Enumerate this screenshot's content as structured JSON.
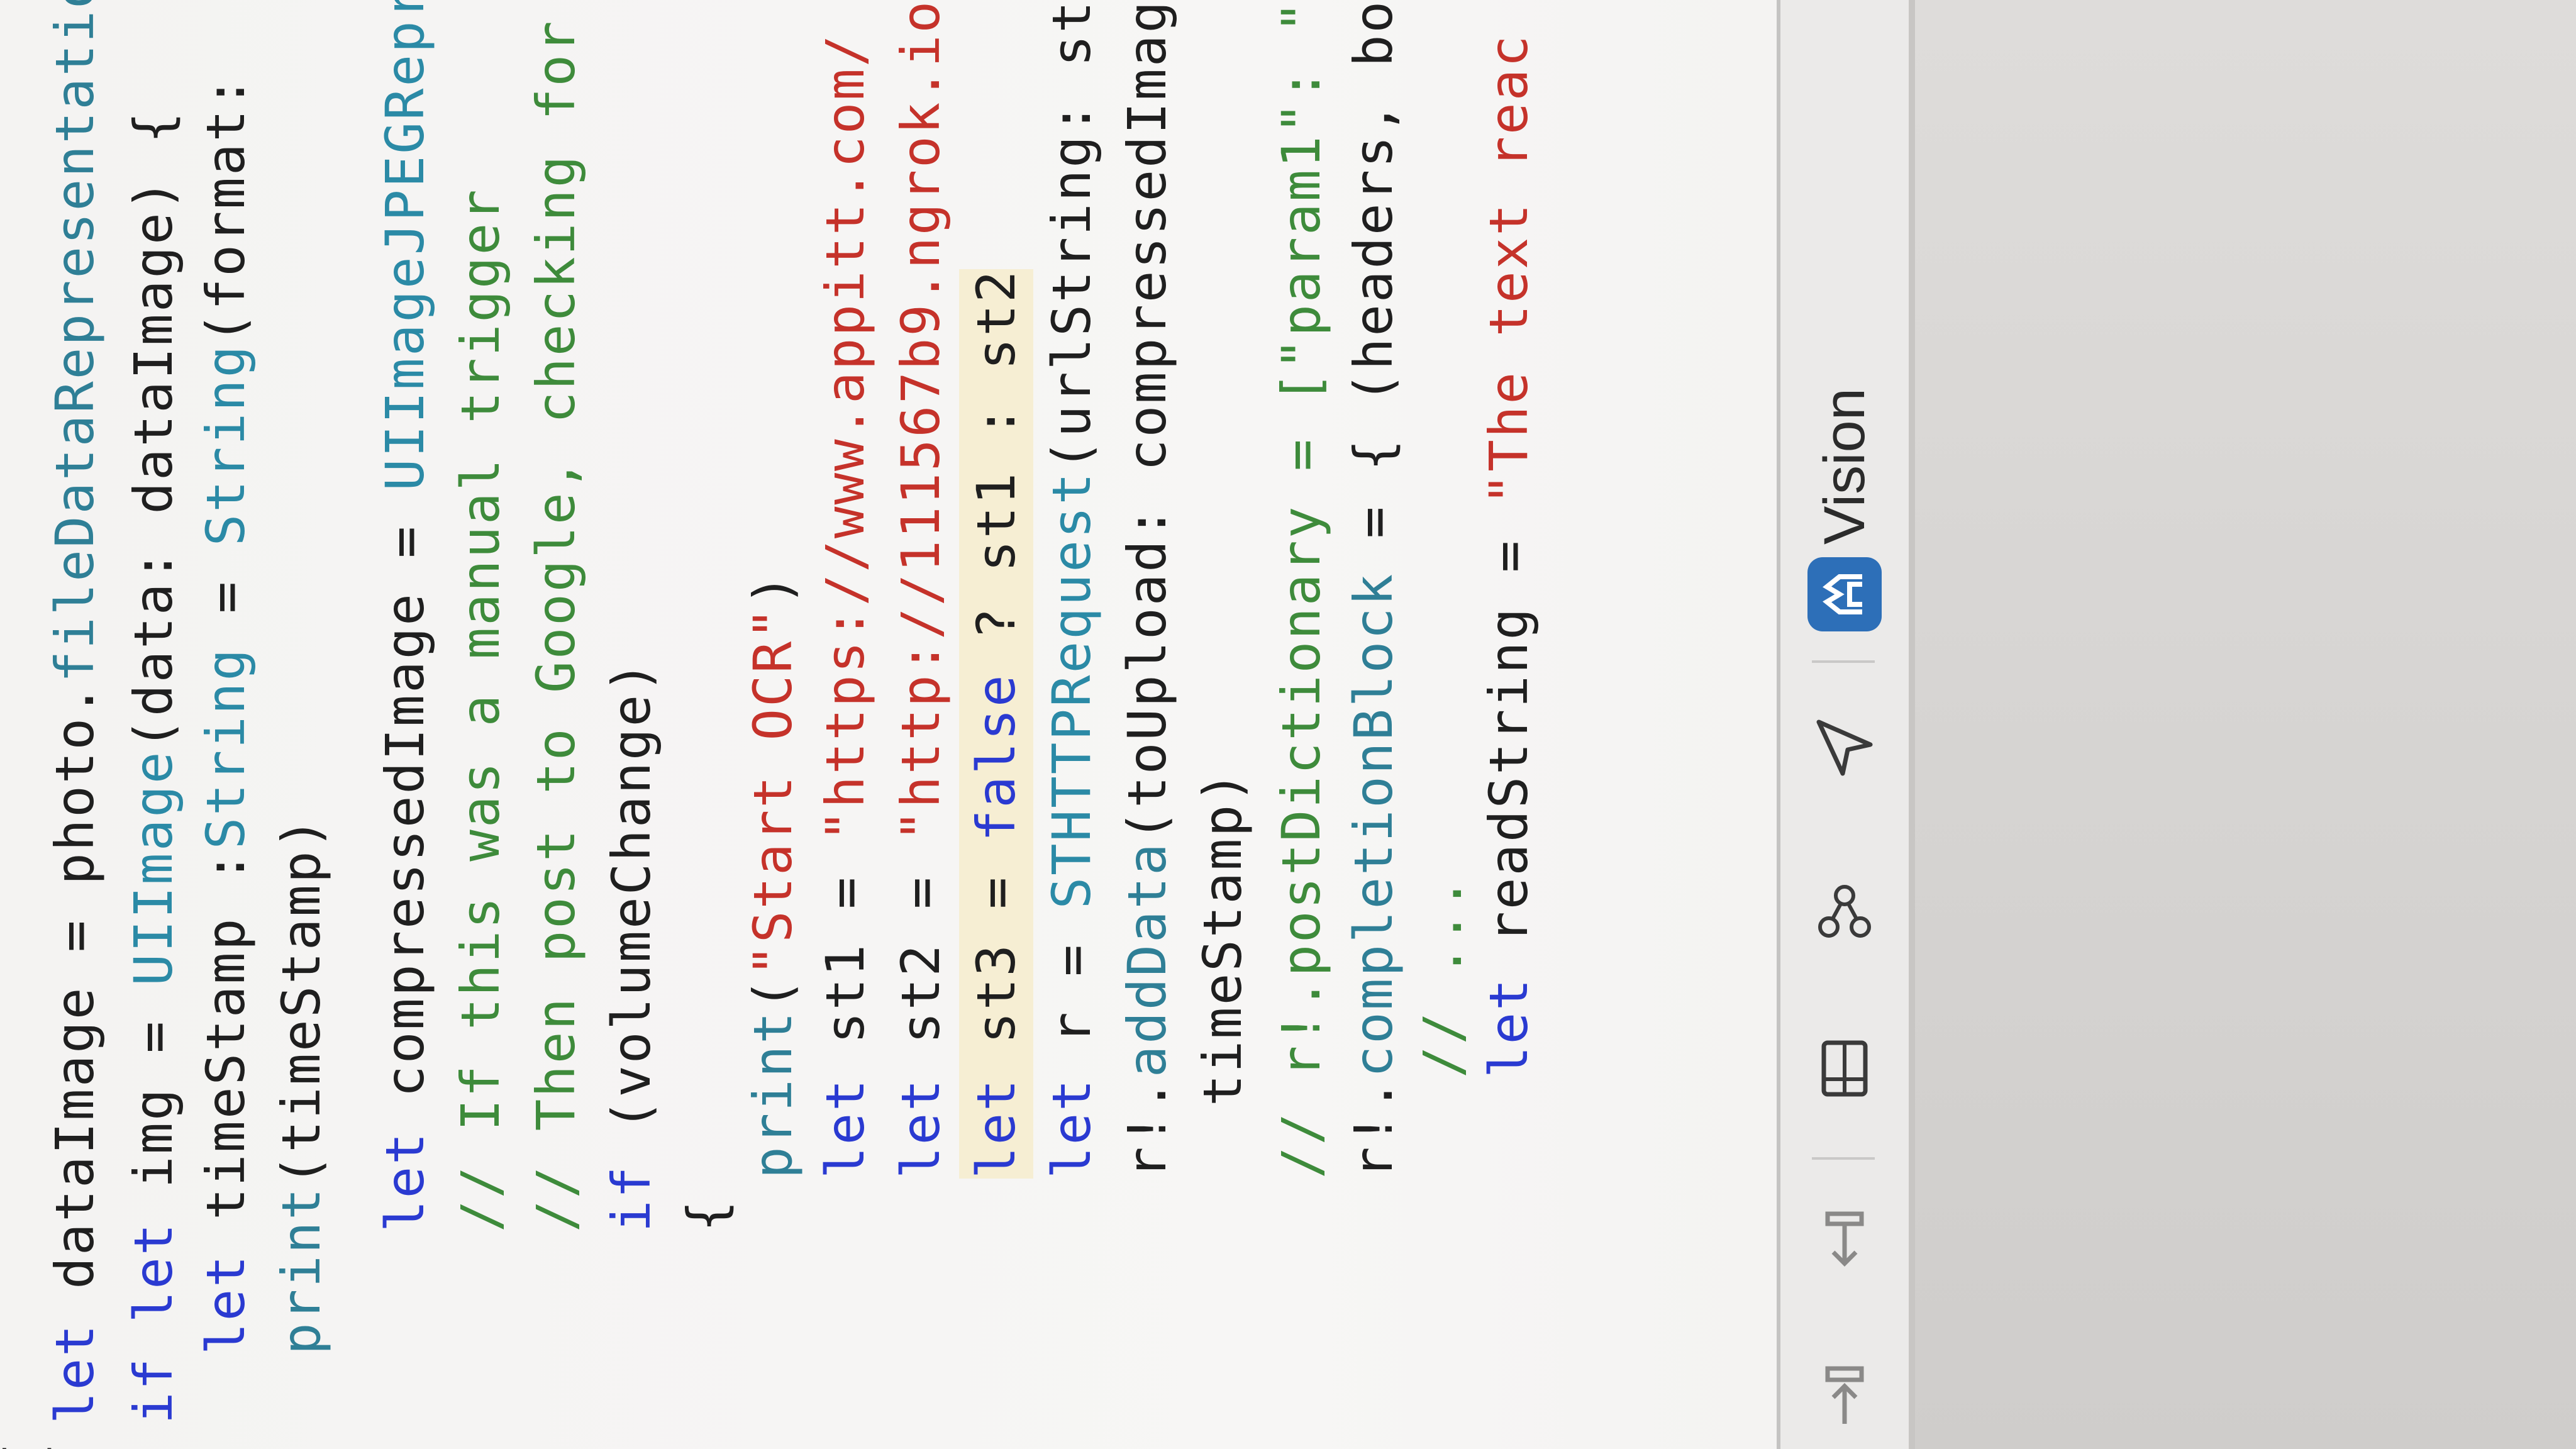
{
  "editor": {
    "lines": [
      {
        "id": "l0",
        "segments": [
          {
            "t": "{",
            "c": ""
          }
        ]
      },
      {
        "id": "l1",
        "segments": [
          {
            "t": "let",
            "c": "kw"
          },
          {
            "t": " dataImage = photo.",
            "c": ""
          },
          {
            "t": "fileDataRepresentatio",
            "c": "fn"
          }
        ]
      },
      {
        "id": "l2",
        "segments": [
          {
            "t": "if",
            "c": "kw"
          },
          {
            "t": " ",
            "c": ""
          },
          {
            "t": "let",
            "c": "kw"
          },
          {
            "t": " img = ",
            "c": ""
          },
          {
            "t": "UIImage",
            "c": "ty"
          },
          {
            "t": "(data: dataImage) {",
            "c": ""
          }
        ]
      },
      {
        "id": "l3",
        "segments": [
          {
            "t": "let",
            "c": "kw"
          },
          {
            "t": " timeStamp :",
            "c": ""
          },
          {
            "t": "String",
            "c": "ty"
          },
          {
            "t": " = ",
            "c": ""
          },
          {
            "t": "String",
            "c": "ty"
          },
          {
            "t": "(format: ",
            "c": ""
          }
        ]
      },
      {
        "id": "l4",
        "segments": [
          {
            "t": "print",
            "c": "fn"
          },
          {
            "t": "(timeStamp)",
            "c": ""
          }
        ]
      },
      {
        "id": "l5",
        "segments": [
          {
            "t": "let",
            "c": "kw"
          },
          {
            "t": " compressedImage = ",
            "c": ""
          },
          {
            "t": "UIImageJPEGRepre",
            "c": "ty"
          }
        ]
      },
      {
        "id": "l6",
        "segments": [
          {
            "t": "// If this was a manual trigger",
            "c": "cm"
          }
        ]
      },
      {
        "id": "l7",
        "segments": [
          {
            "t": "// Then post to Google, checking for t",
            "c": "cm"
          }
        ]
      },
      {
        "id": "l8",
        "segments": [
          {
            "t": "if",
            "c": "kw"
          },
          {
            "t": " (volumeChange)",
            "c": ""
          }
        ]
      },
      {
        "id": "l9",
        "segments": [
          {
            "t": "{",
            "c": ""
          }
        ]
      },
      {
        "id": "l10",
        "segments": [
          {
            "t": "print",
            "c": "fn"
          },
          {
            "t": "(",
            "c": ""
          },
          {
            "t": "\"Start OCR\"",
            "c": "str"
          },
          {
            "t": ")",
            "c": ""
          }
        ]
      },
      {
        "id": "l11",
        "segments": [
          {
            "t": "let",
            "c": "kw"
          },
          {
            "t": " st1 = ",
            "c": ""
          },
          {
            "t": "\"https://www.appitt.com/",
            "c": "str"
          }
        ]
      },
      {
        "id": "l12",
        "segments": [
          {
            "t": "let",
            "c": "kw"
          },
          {
            "t": " st2 = ",
            "c": ""
          },
          {
            "t": "\"http://111567b9.ngrok.io",
            "c": "str"
          }
        ]
      },
      {
        "id": "l13",
        "segments": [
          {
            "t": "let",
            "c": "kw"
          },
          {
            "t": " st3 = ",
            "c": ""
          },
          {
            "t": "false",
            "c": "kw"
          },
          {
            "t": " ? st1 : st2",
            "c": ""
          }
        ]
      },
      {
        "id": "l14",
        "segments": [
          {
            "t": "let",
            "c": "kw"
          },
          {
            "t": " r = ",
            "c": ""
          },
          {
            "t": "STHTTPRequest",
            "c": "ty"
          },
          {
            "t": "(urlString: st",
            "c": ""
          }
        ]
      },
      {
        "id": "l15",
        "segments": [
          {
            "t": "r!.",
            "c": ""
          },
          {
            "t": "addData",
            "c": "fn"
          },
          {
            "t": "(toUpload: compressedImag",
            "c": ""
          }
        ]
      },
      {
        "id": "l16",
        "segments": [
          {
            "t": "timeStamp)",
            "c": ""
          }
        ]
      },
      {
        "id": "l17",
        "segments": [
          {
            "t": "// r!.postDictionary = [\"param1\": \"",
            "c": "cm"
          }
        ]
      },
      {
        "id": "l18",
        "segments": [
          {
            "t": "r!.",
            "c": ""
          },
          {
            "t": "completionBlock",
            "c": "fn"
          },
          {
            "t": " = { (headers, bo",
            "c": ""
          }
        ]
      },
      {
        "id": "l19",
        "segments": [
          {
            "t": "// ...",
            "c": "cm"
          }
        ]
      },
      {
        "id": "l20",
        "segments": [
          {
            "t": "let",
            "c": "kw"
          },
          {
            "t": " readString = ",
            "c": ""
          },
          {
            "t": "\"The text reac",
            "c": "str"
          }
        ]
      }
    ]
  },
  "toolbar": {
    "vision_label": "Vision",
    "icons": [
      "indent-icon",
      "outdent-icon",
      "split-view-icon",
      "share-nodes-icon",
      "send-icon",
      "vision-app-icon"
    ]
  },
  "colors": {
    "keyword": "#2a3ad1",
    "type": "#2b8aa6",
    "function": "#2f7f96",
    "string": "#c5322a",
    "comment": "#3e8b3b"
  }
}
